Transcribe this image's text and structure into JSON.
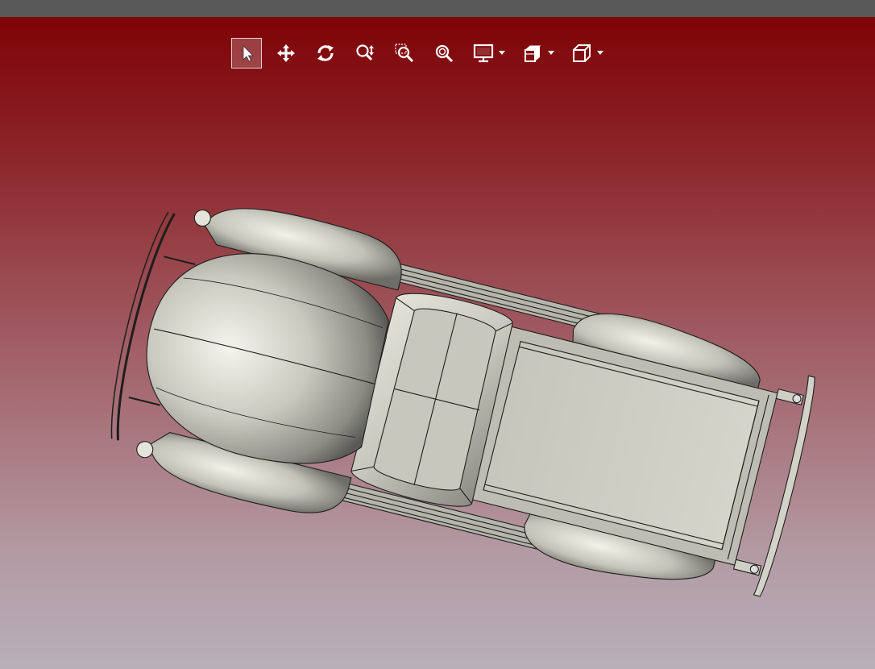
{
  "toolbar": {
    "buttons": [
      {
        "name": "select-tool",
        "icon": "cursor-arrow-icon",
        "active": true
      },
      {
        "name": "pan-tool",
        "icon": "move-arrows-icon"
      },
      {
        "name": "rotate-tool",
        "icon": "rotate-icon"
      },
      {
        "name": "zoom-tool",
        "icon": "zoom-vertical-icon"
      },
      {
        "name": "zoom-window-tool",
        "icon": "zoom-window-icon"
      },
      {
        "name": "zoom-fit-tool",
        "icon": "zoom-fit-icon"
      },
      {
        "name": "display-mode",
        "icon": "monitor-icon",
        "dropdown": true
      },
      {
        "name": "section-view",
        "icon": "section-cube-icon",
        "dropdown": true
      },
      {
        "name": "view-orientation",
        "icon": "cube-icon",
        "dropdown": true
      }
    ]
  },
  "colors": {
    "background_top": "#7e0306",
    "background_bottom": "#b8b0b8",
    "model_body": "#cdcdc4",
    "toolbar_icon": "#ffffff"
  },
  "model": {
    "subject": "pickup-truck-3d-model"
  }
}
